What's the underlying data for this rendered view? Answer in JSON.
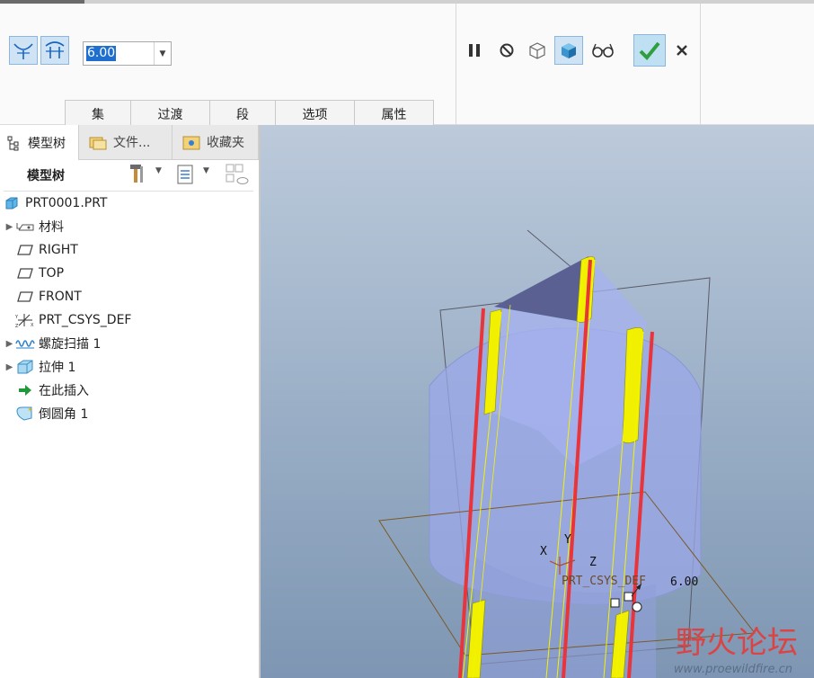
{
  "ribbon": {
    "value_input": "6.00",
    "tabs": [
      "集",
      "过渡",
      "段",
      "选项",
      "属性"
    ]
  },
  "panel": {
    "tabs": [
      "模型树",
      "文件...",
      "收藏夹"
    ],
    "header_title": "模型树",
    "tree": [
      {
        "label": "PRT0001.PRT",
        "icon": "part-icon",
        "expand": false,
        "indent": 0
      },
      {
        "label": "材料",
        "icon": "material-icon",
        "expand": true,
        "indent": 1
      },
      {
        "label": "RIGHT",
        "icon": "datum-plane-icon",
        "expand": false,
        "indent": 1
      },
      {
        "label": "TOP",
        "icon": "datum-plane-icon",
        "expand": false,
        "indent": 1
      },
      {
        "label": "FRONT",
        "icon": "datum-plane-icon",
        "expand": false,
        "indent": 1
      },
      {
        "label": "PRT_CSYS_DEF",
        "icon": "csys-icon",
        "expand": false,
        "indent": 1
      },
      {
        "label": "螺旋扫描 1",
        "icon": "helical-sweep-icon",
        "expand": true,
        "indent": 1
      },
      {
        "label": "拉伸 1",
        "icon": "extrude-icon",
        "expand": true,
        "indent": 1
      },
      {
        "label": "在此插入",
        "icon": "insert-here-icon",
        "expand": false,
        "indent": 1
      },
      {
        "label": "倒圆角 1",
        "icon": "round-icon",
        "expand": false,
        "indent": 1
      }
    ]
  },
  "viewport": {
    "axis_x": "X",
    "axis_y": "Y",
    "axis_z": "Z",
    "csys_label": "PRT_CSYS_DEF",
    "dimension": "6.00",
    "watermark": "野火论坛",
    "watermark_url": "www.proewildfire.cn"
  },
  "colors": {
    "accent_check": "#2f9e3f",
    "selected_button": "#cfe3f5",
    "yellow_strip": "#ffff00",
    "red_line": "#e8343a"
  }
}
